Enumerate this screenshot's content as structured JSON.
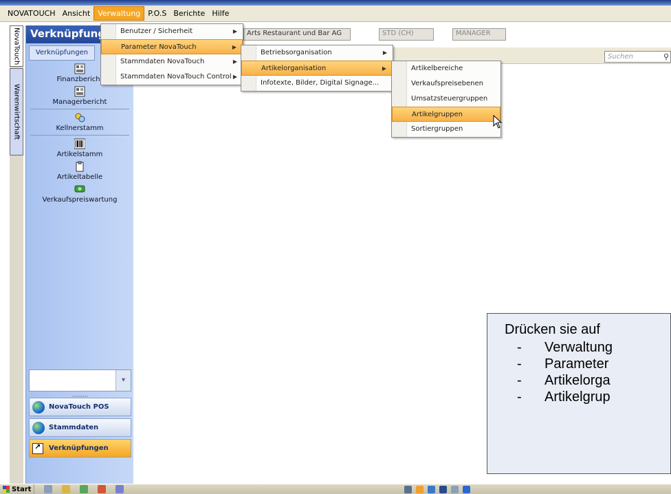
{
  "menubar": {
    "items": [
      "NOVATOUCH",
      "Ansicht",
      "Verwaltung",
      "P.O.S",
      "Berichte",
      "Hilfe"
    ],
    "active_index": 2
  },
  "vertical_tabs": [
    "NovaTouch",
    "Warenwirtschaft"
  ],
  "sidebar": {
    "title": "Verknüpfungen",
    "subtab": "Verknüpfungen",
    "items": [
      {
        "label": "Finanzbericht",
        "icon": "report-icon"
      },
      {
        "label": "Managerbericht",
        "icon": "report-icon"
      },
      {
        "label": "Kellnerstamm",
        "icon": "waiters-icon"
      },
      {
        "label": "Artikelstamm",
        "icon": "barcode-icon"
      },
      {
        "label": "Artikeltabelle",
        "icon": "clipboard-icon"
      },
      {
        "label": "Verkaufspreiswartung",
        "icon": "price-icon"
      }
    ],
    "grip": "·········",
    "nav_buttons": [
      "NovaTouch POS",
      "Stammdaten",
      "Verknüpfungen"
    ],
    "active_nav": 2
  },
  "info": {
    "company": "Arts Restaurant und Bar AG",
    "currency": "STD (CH)",
    "role": "MANAGER"
  },
  "search": {
    "placeholder": "Suchen"
  },
  "menus": {
    "verwaltung": {
      "items": [
        "Benutzer / Sicherheit",
        "Parameter NovaTouch",
        "Stammdaten NovaTouch",
        "Stammdaten NovaTouch Control"
      ],
      "highlight": 1
    },
    "parameter": {
      "items": [
        "Betriebsorganisation",
        "Artikelorganisation",
        "Infotexte, Bilder, Digital Signage..."
      ],
      "highlight": 1
    },
    "artikelorganisation": {
      "items": [
        "Artikelbereiche",
        "Verkaufspreisebenen",
        "Umsatzsteuergruppen",
        "Artikelgruppen",
        "Sortiergruppen"
      ],
      "highlight": 3
    }
  },
  "instruction": {
    "heading": "Drücken sie auf",
    "steps": [
      "Verwaltung",
      "Parameter",
      "Artikelorga",
      "Artikelgrup"
    ]
  },
  "taskbar": {
    "start": "Start"
  },
  "colors": {
    "accent": "#f5a623",
    "sidebar": "#a8c2f0",
    "header": "#23479a"
  }
}
